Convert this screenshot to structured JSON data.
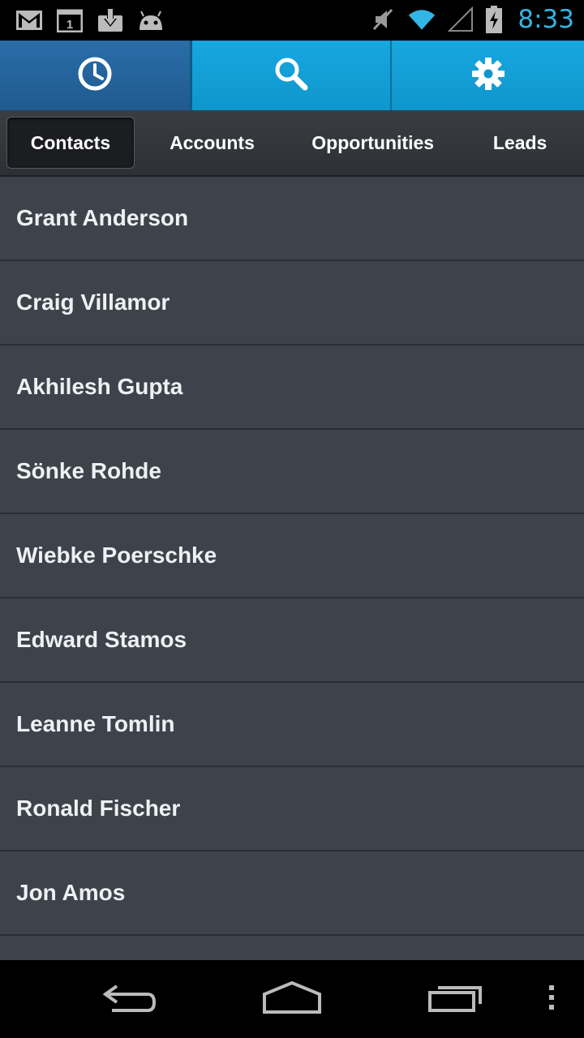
{
  "status_bar": {
    "time": "8:33",
    "icons": [
      "gmail-icon",
      "calendar-icon",
      "download-icon",
      "android-icon",
      "mute-icon",
      "wifi-icon",
      "signal-icon",
      "battery-charging-icon"
    ],
    "calendar_day": "1"
  },
  "action_bar": {
    "buttons": [
      "history-icon",
      "search-icon",
      "settings-icon"
    ]
  },
  "tabs": [
    {
      "label": "Contacts",
      "active": true
    },
    {
      "label": "Accounts",
      "active": false
    },
    {
      "label": "Opportunities",
      "active": false
    },
    {
      "label": "Leads",
      "active": false
    }
  ],
  "contacts": [
    "Grant Anderson",
    "Craig Villamor",
    "Akhilesh Gupta",
    "Sönke Rohde",
    "Wiebke Poerschke",
    "Edward Stamos",
    "Leanne Tomlin",
    "Ronald Fischer",
    "Jon Amos"
  ],
  "nav": [
    "back-icon",
    "home-icon",
    "recents-icon",
    "menu-icon"
  ],
  "colors": {
    "accent": "#33b5e5",
    "action_bar": "#0e96cc",
    "list_bg": "#3e434b"
  }
}
